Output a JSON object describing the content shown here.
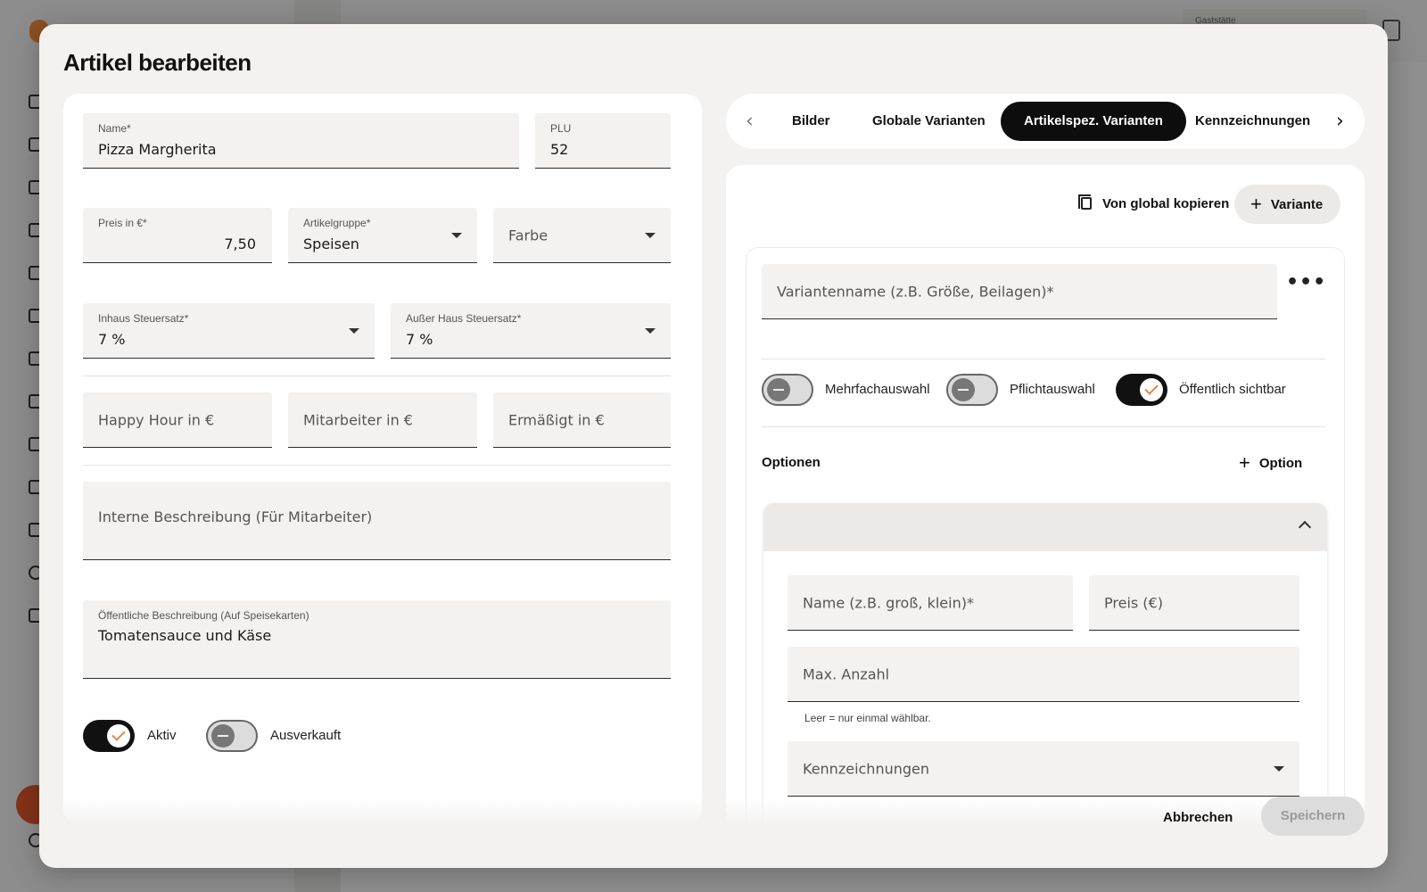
{
  "background": {
    "header_box_label": "Gaststätte"
  },
  "modal": {
    "title": "Artikel bearbeiten",
    "left": {
      "name": {
        "label": "Name*",
        "value": "Pizza Margherita"
      },
      "plu": {
        "label": "PLU",
        "value": "52"
      },
      "preis": {
        "label": "Preis in €*",
        "value": "7,50"
      },
      "artikelgruppe": {
        "label": "Artikelgruppe*",
        "value": "Speisen"
      },
      "farbe": {
        "placeholder": "Farbe"
      },
      "inhaus_steuersatz": {
        "label": "Inhaus Steuersatz*",
        "value": "7 %"
      },
      "ausser_haus_steuersatz": {
        "label": "Außer Haus Steuersatz*",
        "value": "7 %"
      },
      "happy_hour": {
        "placeholder": "Happy Hour in €"
      },
      "mitarbeiter": {
        "placeholder": "Mitarbeiter in €"
      },
      "ermaessigt": {
        "placeholder": "Ermäßigt in €"
      },
      "interne_beschreibung": {
        "placeholder": "Interne Beschreibung (Für Mitarbeiter)"
      },
      "oeffentliche_beschreibung": {
        "label": "Öffentliche Beschreibung (Auf Speisekarten)",
        "value": "Tomatensauce und Käse"
      },
      "toggles": [
        {
          "label": "Aktiv",
          "on": true
        },
        {
          "label": "Ausverkauft",
          "on": false
        }
      ]
    },
    "tabs": {
      "prev_icon": "chevron-left-icon",
      "next_icon": "chevron-right-icon",
      "items": [
        "Bilder",
        "Globale Varianten",
        "Artikelspez. Varianten",
        "Kennzeichnungen"
      ],
      "active": "Artikelspez. Varianten"
    },
    "variants": {
      "copy_button": "Von global kopieren",
      "add_variant_button": "Variante",
      "variant_name_placeholder": "Variantenname (z.B. Größe, Beilagen)*",
      "toggles": [
        {
          "label": "Mehrfachauswahl",
          "on": false
        },
        {
          "label": "Pflichtauswahl",
          "on": false
        },
        {
          "label": "Öffentlich sichtbar",
          "on": true
        }
      ],
      "options_label": "Optionen",
      "add_option_button": "Option",
      "option": {
        "name_placeholder": "Name (z.B. groß, klein)*",
        "price_placeholder": "Preis (€)",
        "max_placeholder": "Max. Anzahl",
        "max_helper": "Leer = nur einmal wählbar.",
        "kennzeichnungen_placeholder": "Kennzeichnungen"
      }
    },
    "footer": {
      "cancel": "Abbrechen",
      "save": "Speichern"
    }
  },
  "colors": {
    "accent_check": "#e0874c",
    "toggle_on": "#111111",
    "active_tab": "#0d0d0d"
  }
}
